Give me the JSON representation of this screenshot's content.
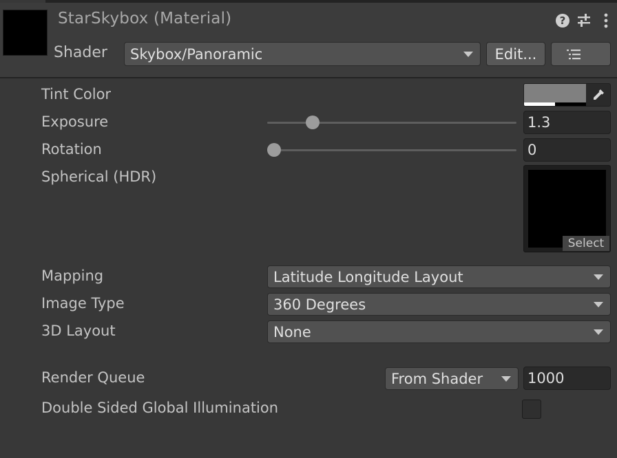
{
  "header": {
    "title": "StarSkybox (Material)",
    "shader_label": "Shader",
    "shader_value": "Skybox/Panoramic",
    "edit_label": "Edit..."
  },
  "properties": {
    "tint_color": {
      "label": "Tint Color",
      "color": "#808080"
    },
    "exposure": {
      "label": "Exposure",
      "value": "1.3",
      "slider_fraction": 0.16
    },
    "rotation": {
      "label": "Rotation",
      "value": "0",
      "slider_fraction": 0.0
    },
    "spherical": {
      "label": "Spherical  (HDR)",
      "select_label": "Select"
    },
    "mapping": {
      "label": "Mapping",
      "value": "Latitude Longitude Layout"
    },
    "image_type": {
      "label": "Image Type",
      "value": "360 Degrees"
    },
    "layout_3d": {
      "label": "3D Layout",
      "value": "None"
    },
    "render_queue": {
      "label": "Render Queue",
      "mode": "From Shader",
      "value": "1000"
    },
    "double_sided_gi": {
      "label": "Double Sided Global Illumination",
      "checked": false
    }
  },
  "colors": {
    "background": "#383838",
    "header": "#3c3c3c",
    "field": "#2a2a2a",
    "dropdown": "#515151"
  },
  "icons": [
    "help-icon",
    "sliders-icon",
    "kebab-icon",
    "chevron-down-icon",
    "list-icon",
    "eyedropper-icon"
  ]
}
